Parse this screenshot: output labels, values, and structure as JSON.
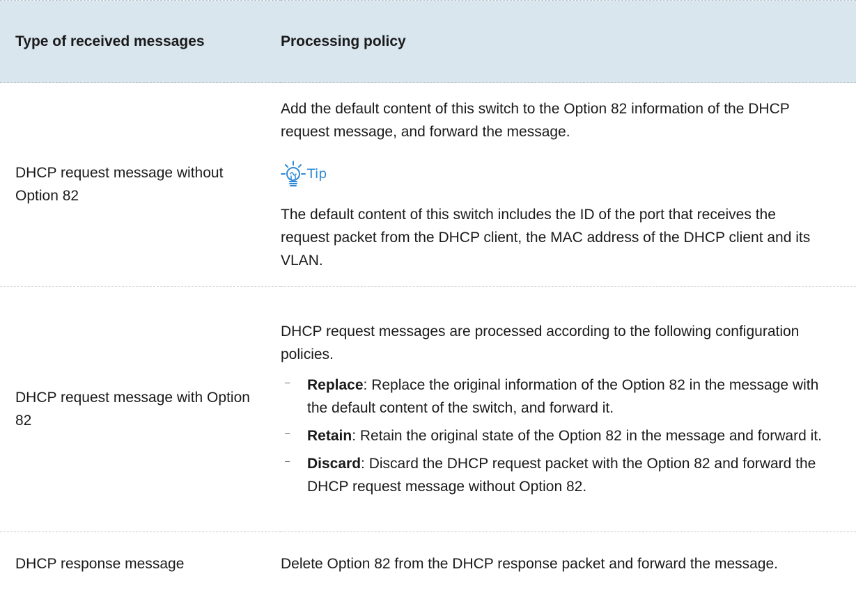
{
  "table": {
    "headers": {
      "type": "Type of received messages",
      "policy": "Processing policy"
    },
    "rows": [
      {
        "type": "DHCP request message without Option 82",
        "policy_text": "Add the default content of this switch to the Option 82 information of the DHCP request message, and forward the message.",
        "tip_label": "Tip",
        "tip_text": "The default content of this switch includes the ID of the port that receives the request packet from the DHCP client, the MAC address of the DHCP client and its VLAN."
      },
      {
        "type": "DHCP request message with Option 82",
        "policy_text": "DHCP request messages are processed according to the following configuration policies.",
        "bullets": [
          {
            "keyword": "Replace",
            "text": ": Replace the original information of the Option 82 in the message with the default content of the switch, and forward it."
          },
          {
            "keyword": "Retain",
            "text": ": Retain the original state of the Option 82 in the message and forward it."
          },
          {
            "keyword": "Discard",
            "text": ": Discard the DHCP request packet with the Option 82 and forward the DHCP request message without Option 82."
          }
        ]
      },
      {
        "type": "DHCP response message",
        "policy_text": "Delete Option 82 from the DHCP response packet and forward the message."
      }
    ]
  },
  "colors": {
    "header_bg": "#d9e6ee",
    "tip_accent": "#2f89d6"
  },
  "icons": {
    "tip": "lightbulb-icon",
    "bullet": "dash"
  }
}
